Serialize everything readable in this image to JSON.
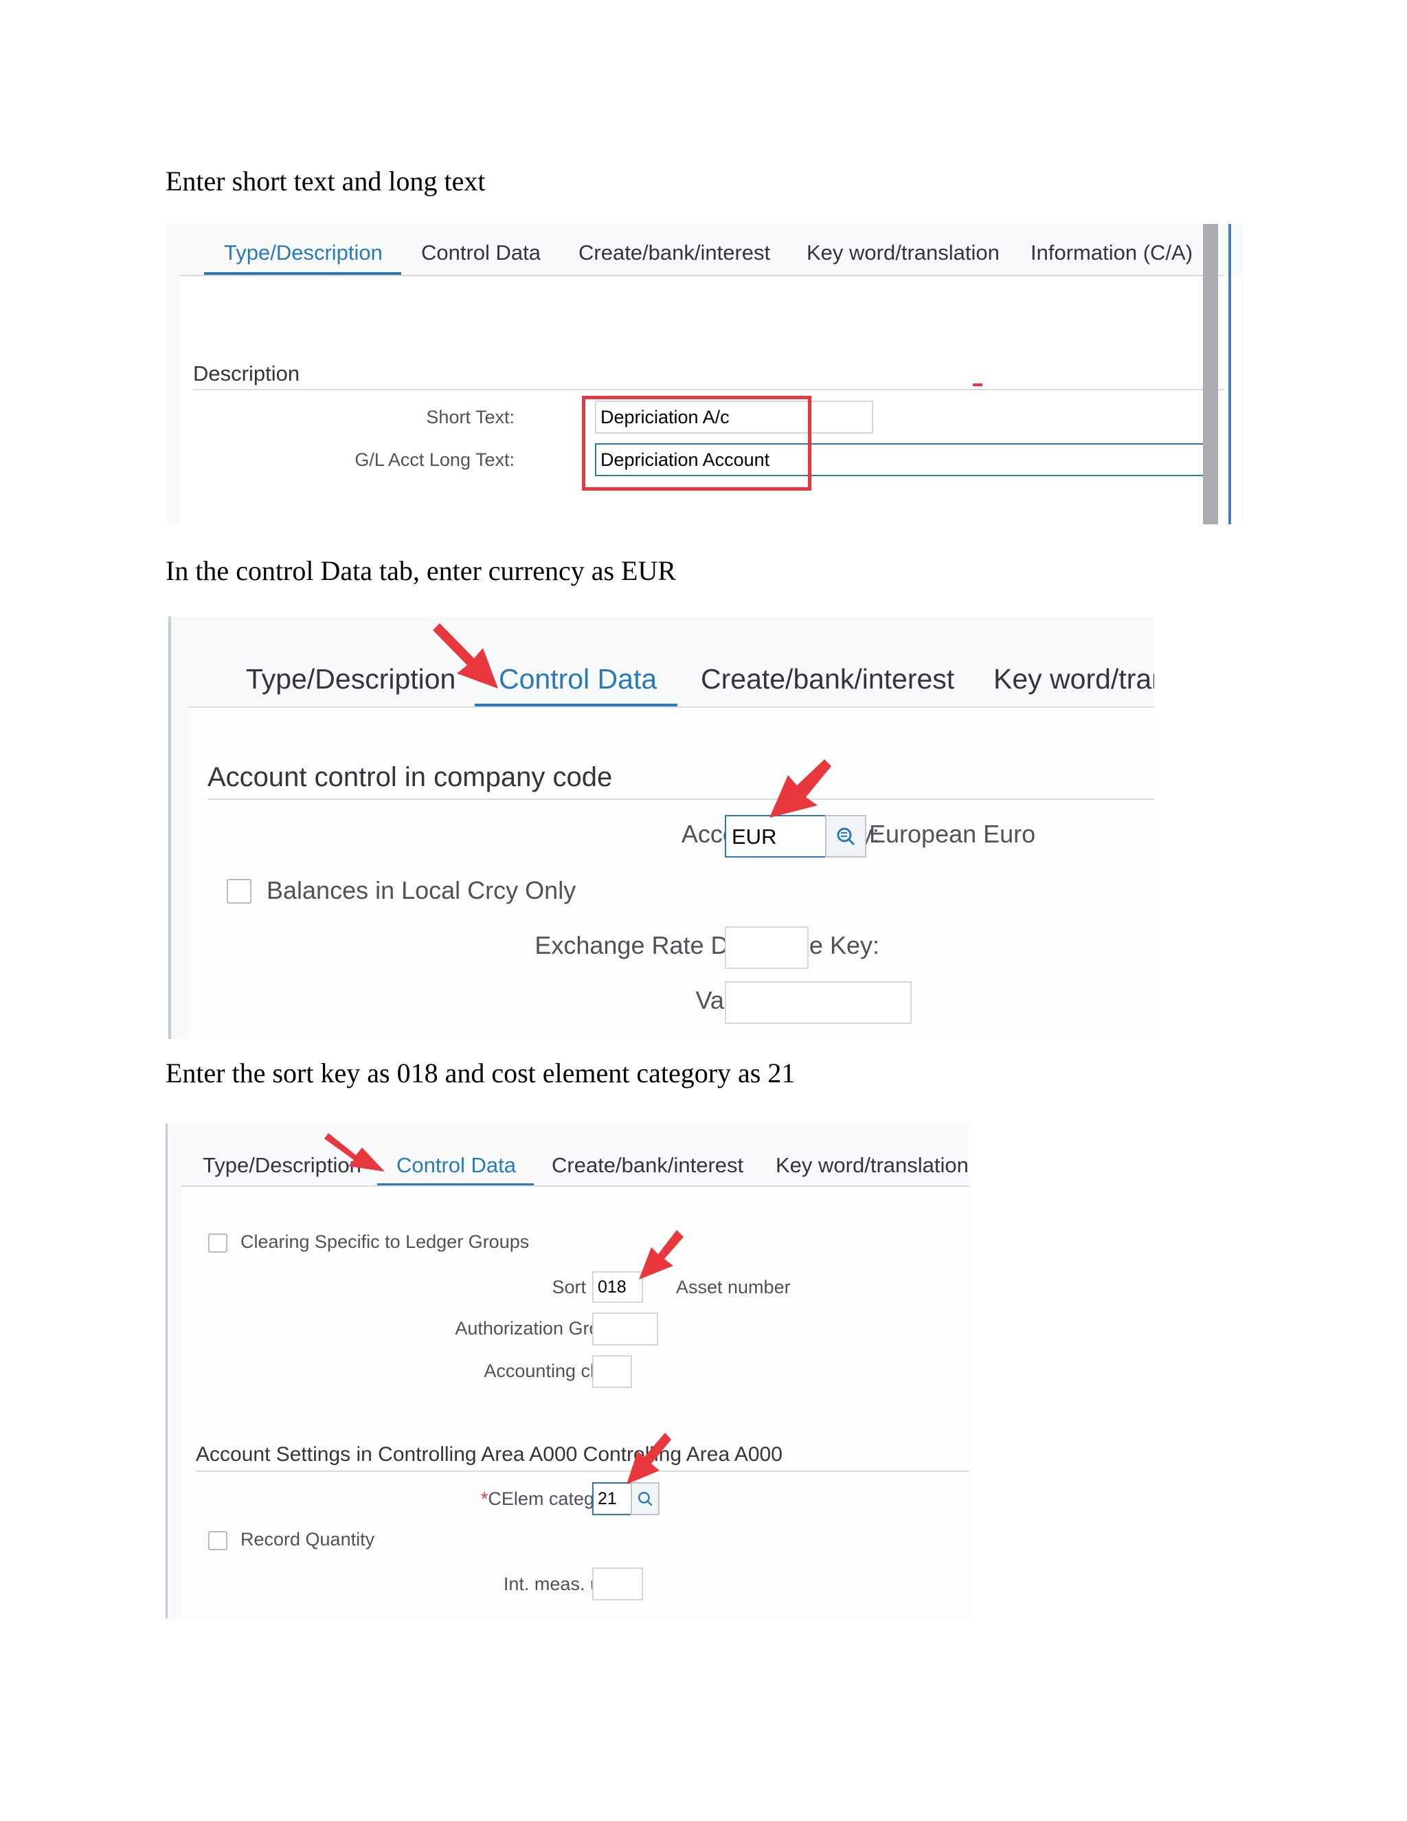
{
  "instructions": {
    "step1": "Enter short text and long text",
    "step2": "In the control Data tab, enter currency as EUR",
    "step3": "Enter the sort key as 018 and cost element category as 21"
  },
  "panel1": {
    "tabs": [
      "Type/Description",
      "Control Data",
      "Create/bank/interest",
      "Key word/translation",
      "Information (C/A)"
    ],
    "section_title": "Description",
    "short_text_label": "Short Text:",
    "short_text_value": "Depriciation A/c",
    "long_text_label": "G/L Acct Long Text:",
    "long_text_value": "Depriciation Account"
  },
  "panel2": {
    "tabs": [
      "Type/Description",
      "Control Data",
      "Create/bank/interest",
      "Key word/trar"
    ],
    "section_title": "Account control in company code",
    "currency_label": "Account currency:",
    "currency_value": "EUR",
    "currency_desc": "European Euro",
    "balances_label": "Balances in Local Crcy Only",
    "exrate_label": "Exchange Rate Difference Key:",
    "valuation_label": "Valuation Group:"
  },
  "panel3": {
    "tabs": [
      "Type/Description",
      "Control Data",
      "Create/bank/interest",
      "Key word/translation"
    ],
    "clearing_label": "Clearing Specific to Ledger Groups",
    "sort_key_label": "Sort key:",
    "sort_key_value": "018",
    "sort_key_desc": "Asset number",
    "auth_group_label": "Authorization Group:",
    "acct_clerk_label": "Accounting clerk:",
    "section_title": "Account Settings in Controlling Area A000 Controlling Area A000",
    "required_mark": "*",
    "celem_label": "CElem category:",
    "celem_value": "21",
    "record_qty_label": "Record Quantity",
    "int_meas_label": "Int. meas. unit:"
  },
  "colors": {
    "accent": "#2a7ab8",
    "highlight": "#e8383d"
  },
  "icons": [
    "value-help-icon",
    "red-arrow-icon"
  ]
}
